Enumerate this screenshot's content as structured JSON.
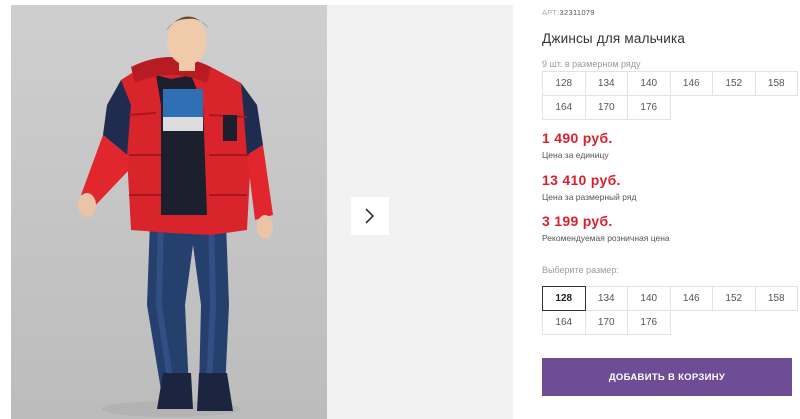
{
  "gallery": {
    "photo_alt": "",
    "next_icon": "chevron-right-icon"
  },
  "product": {
    "sku_label": "АРТ:",
    "sku": "32311079",
    "title": "Джинсы для мальчика",
    "pack_label": "9 шт. в размерном ряду",
    "pack_sizes": [
      "128",
      "134",
      "140",
      "146",
      "152",
      "158",
      "164",
      "170",
      "176"
    ]
  },
  "prices": [
    {
      "value": "1 490 руб.",
      "note": "Цена за единицу"
    },
    {
      "value": "13 410 руб.",
      "note": "Цена за размерный ряд"
    },
    {
      "value": "3 199 руб.",
      "note": "Рекомендуемая розничная цена"
    }
  ],
  "size_picker": {
    "label": "Выберите размер:",
    "selected": "128",
    "sizes": [
      "128",
      "134",
      "140",
      "146",
      "152",
      "158",
      "164",
      "170",
      "176"
    ]
  },
  "cart_button": {
    "label": "ДОБАВИТЬ В КОРЗИНУ",
    "color": "#6e4d96"
  },
  "colors": {
    "price": "#d8202c"
  }
}
